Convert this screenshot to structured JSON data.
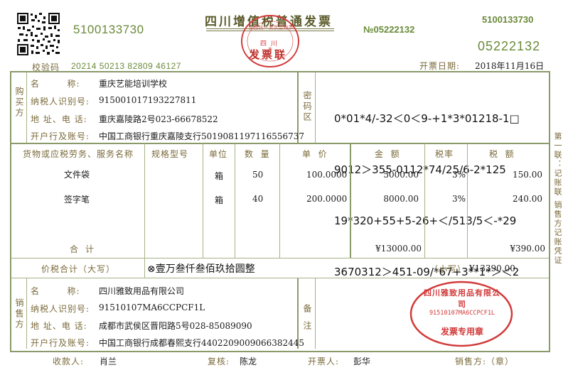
{
  "header": {
    "code_left": "5100133730",
    "title": "四川增值税普通发票",
    "no_label": "№",
    "no_value": "05222132",
    "code_right": "5100133730",
    "number_right": "05222132",
    "check_label": "校验码",
    "check_code": "20214 50213 82809 46127",
    "date_label": "开票日期:",
    "date_value": "2018年11月16日"
  },
  "buyer": {
    "side_label": "购买方",
    "name_label": "名        称:",
    "name": "重庆艺能培训学校",
    "tax_label": "纳税人识别号:",
    "tax_id": "915001017193227811",
    "addr_label": "地 址、电 话:",
    "addr": "重庆嘉陵路2号023-66678522",
    "bank_label": "开户行及账号:",
    "bank": "中国工商银行重庆嘉陵支行5019081197116556737"
  },
  "cipher": {
    "label": "密码区",
    "lines": [
      "0*01*4/-32＜0＜9-+1*3*01218-1□",
      "9012＞355-0112*74/25/6-2*125",
      "19*320+55+5-26+＜/513/5＜-*29",
      "3670312＞451-09/*67+3**1*＞＜2"
    ]
  },
  "columns": {
    "goods": "货物或应税劳务、服务名称",
    "spec": "规格型号",
    "unit": "单位",
    "qty": "数  量",
    "price": "单  价",
    "amount": "金  额",
    "rate": "税率",
    "tax": "税  额"
  },
  "items": [
    {
      "name": "文件袋",
      "unit": "箱",
      "qty": "50",
      "price": "100.0000",
      "amount": "5000.00",
      "rate": "3%",
      "tax": "150.00"
    },
    {
      "name": "签字笔",
      "unit": "箱",
      "qty": "40",
      "price": "200.0000",
      "amount": "8000.00",
      "rate": "3%",
      "tax": "240.00"
    }
  ],
  "totals": {
    "label": "合计",
    "amount": "¥13000.00",
    "tax": "¥390.00"
  },
  "grand": {
    "label": "价税合计（大写）",
    "words": "⊗壹万叁仟叁佰玖拾圆整",
    "small_label": "（小写）",
    "small_value": "¥13390.00"
  },
  "seller": {
    "side_label": "销售方",
    "name_label": "名        称:",
    "name": "四川雅致用品有限公司",
    "tax_label": "纳税人识别号:",
    "tax_id": "91510107MA6CCPCF1L",
    "addr_label": "地 址、电 话:",
    "addr": "成都市武侯区晋阳路5号028-85089090",
    "bank_label": "开户行及账号:",
    "bank": "中国工商银行成都春熙支行4402209009066382445"
  },
  "remarks": {
    "label": "备注"
  },
  "seal": {
    "company": "四川雅致用品有限公司",
    "tax_id": "91510107MA6CCPCF1L",
    "text": "发票专用章"
  },
  "header_seal": {
    "ring": "全国统一发票监制章",
    "center": "四川",
    "text": "发票联"
  },
  "footer": {
    "payee_label": "收款人:",
    "payee": "肖兰",
    "review_label": "复核:",
    "review": "陈龙",
    "drawer_label": "开票人:",
    "drawer": "彭华",
    "seller_label": "销售方:（章）"
  },
  "side_note": "第一联：记账联 销售方记账凭证",
  "colors": {
    "frame": "#8a9a6a",
    "label": "#7a6a3a",
    "header_green": "#6a8a3a",
    "seal_red": "#d23a3a"
  }
}
